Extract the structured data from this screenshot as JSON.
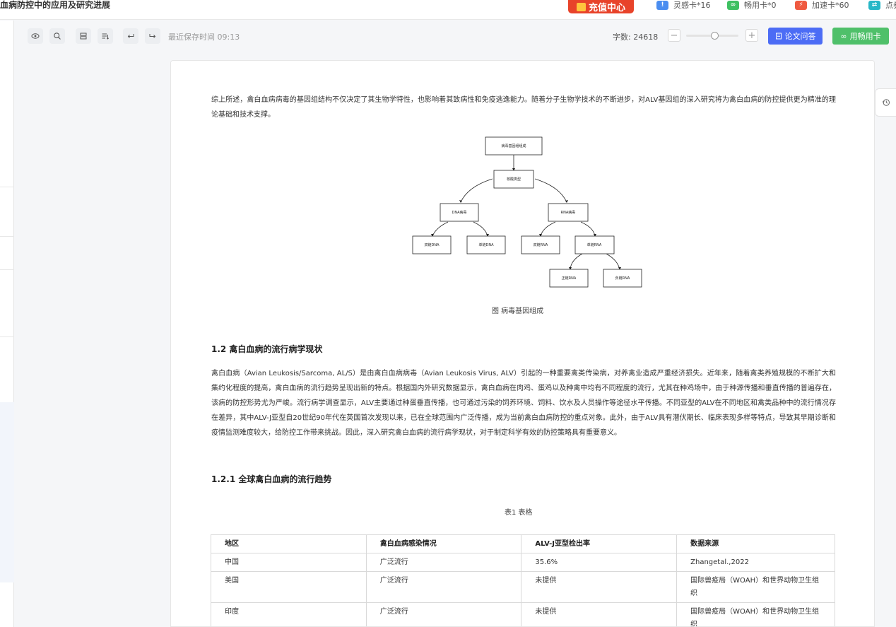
{
  "header": {
    "doc_title": "血病防控中的应用及研究进展",
    "recharge_label": "充值中心",
    "cards": [
      {
        "label": "灵感卡*16",
        "icon": "!",
        "color": "#4a8df0"
      },
      {
        "label": "畅用卡*0",
        "icon": "∞",
        "color": "#3ec061"
      },
      {
        "label": "加速卡*60",
        "icon": "⚡",
        "color": "#ef5a40"
      },
      {
        "label": "点券",
        "icon": "⇄",
        "color": "#27b7c7"
      }
    ]
  },
  "toolbar": {
    "save_time": "最近保存时间 09:13",
    "word_count": "字数: 24618",
    "zoom_level": 0.5,
    "qa_label": "论文问答",
    "use_card_label": "用畅用卡"
  },
  "document": {
    "para_intro": "综上所述，禽白血病病毒的基因组结构不仅决定了其生物学特性，也影响着其致病性和免疫逃逸能力。随着分子生物学技术的不断进步，对ALV基因组的深入研究将为禽白血病的防控提供更为精准的理论基础和技术支撑。",
    "diagram": {
      "root": "病毒基因组组成",
      "level1": "核酸类型",
      "dna": "DNA病毒",
      "rna": "RNA病毒",
      "ds_dna": "双链DNA",
      "ss_dna": "单链DNA",
      "ds_rna": "双链RNA",
      "ss_rna": "单链RNA",
      "pos_rna": "正链RNA",
      "neg_rna": "负链RNA"
    },
    "figure_caption": "图   病毒基因组成",
    "h_1_2": "1.2 禽白血病的流行病学现状",
    "para_epi": "禽白血病（Avian Leukosis/Sarcoma, AL/S）是由禽白血病病毒（Avian Leukosis Virus, ALV）引起的一种重要禽类传染病，对养禽业造成严重经济损失。近年来，随着禽类养殖规模的不断扩大和集约化程度的提高，禽白血病的流行趋势呈现出新的特点。根据国内外研究数据显示，禽白血病在肉鸡、蛋鸡以及种禽中均有不同程度的流行，尤其在种鸡场中，由于种源传播和垂直传播的普遍存在，该病的防控形势尤为严峻。流行病学调查显示，ALV主要通过种蛋垂直传播，也可通过污染的饲养环境、饲料、饮水及人员操作等途径水平传播。不同亚型的ALV在不同地区和禽类品种中的流行情况存在差异，其中ALV-J亚型自20世纪90年代在英国首次发现以来，已在全球范围内广泛传播，成为当前禽白血病防控的重点对象。此外，由于ALV具有潜伏期长、临床表现多样等特点，导致其早期诊断和疫情监测难度较大，给防控工作带来挑战。因此，深入研究禽白血病的流行病学现状，对于制定科学有效的防控策略具有重要意义。",
    "h_1_2_1": "1.2.1 全球禽白血病的流行趋势",
    "table_caption": "表1  表格",
    "table": {
      "headers": [
        "地区",
        "禽白血病感染情况",
        "ALV-J亚型检出率",
        "数据来源"
      ],
      "rows": [
        [
          "中国",
          "广泛流行",
          "35.6%",
          "Zhangetal.,2022"
        ],
        [
          "美国",
          "广泛流行",
          "未提供",
          "国际兽疫局（WOAH）和世界动物卫生组织"
        ],
        [
          "印度",
          "广泛流行",
          "未提供",
          "国际兽疫局（WOAH）和世界动物卫生组织"
        ]
      ]
    }
  }
}
